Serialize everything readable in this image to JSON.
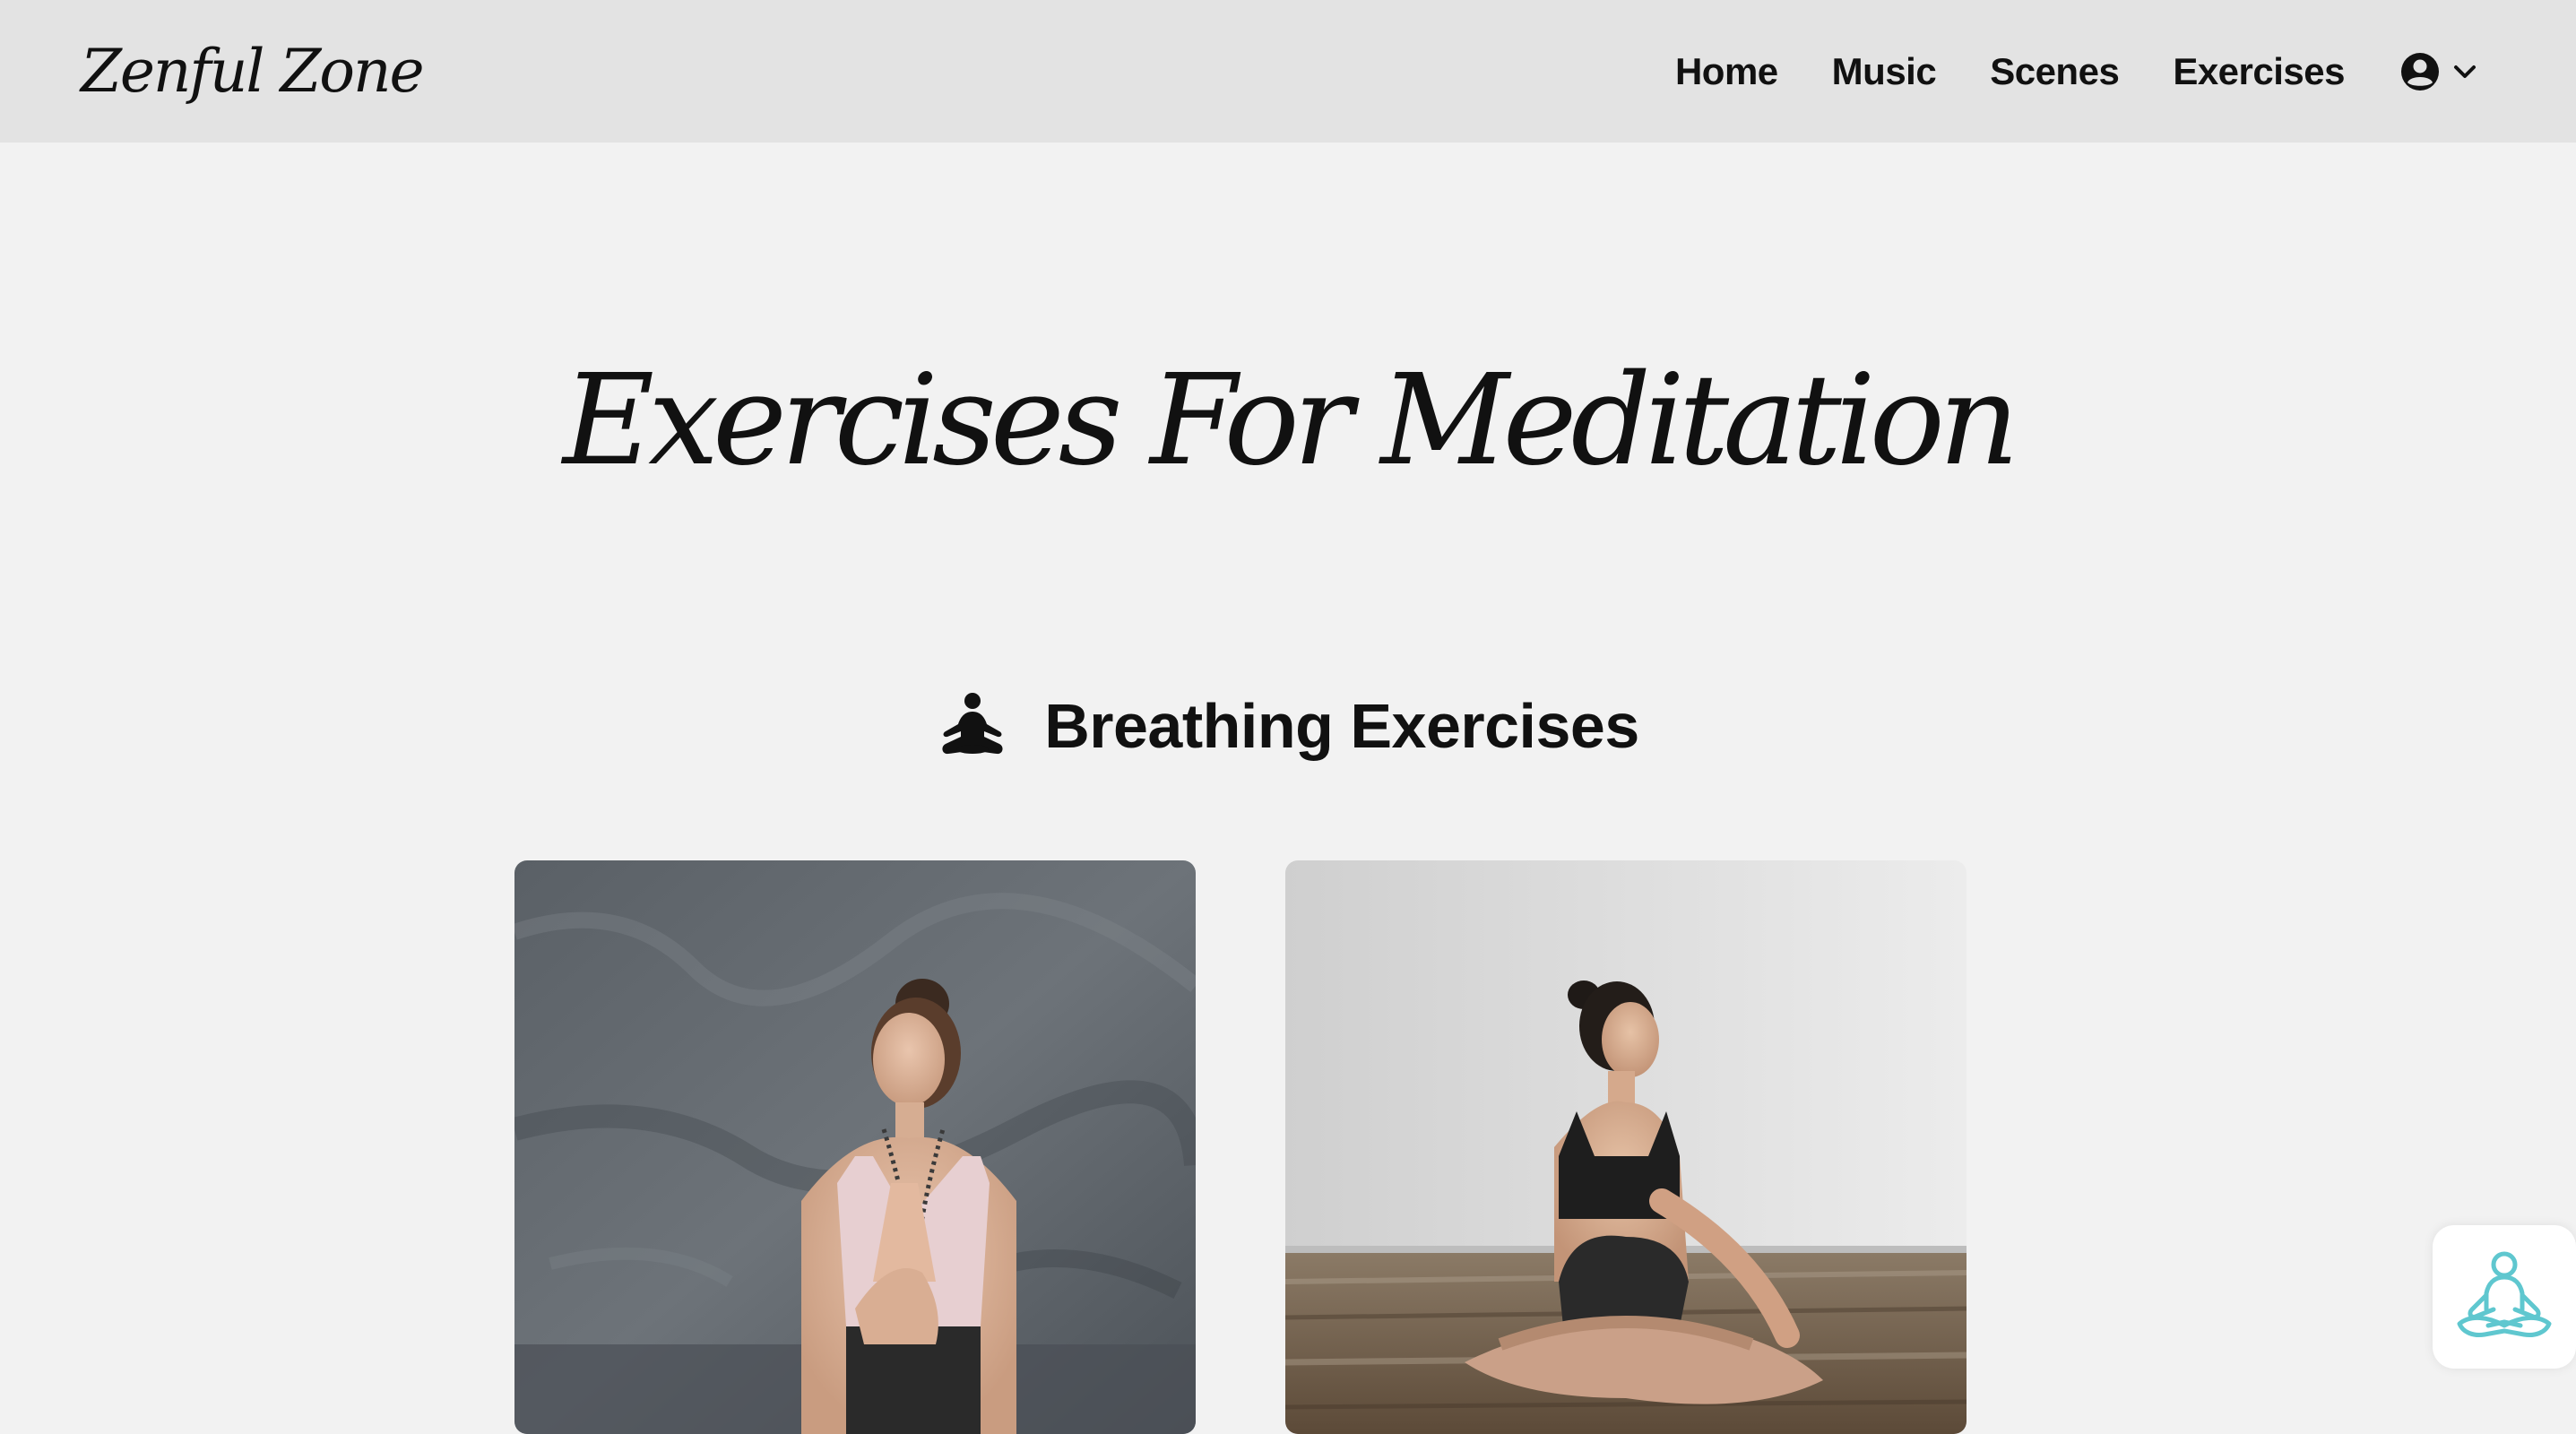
{
  "brand": {
    "logo_text": "Zenful Zone"
  },
  "nav": {
    "links": [
      {
        "label": "Home"
      },
      {
        "label": "Music"
      },
      {
        "label": "Scenes"
      },
      {
        "label": "Exercises"
      }
    ],
    "user_icon": "user-circle-icon",
    "dropdown_icon": "chevron-down-icon"
  },
  "page": {
    "title": "Exercises For Meditation"
  },
  "section": {
    "icon": "meditation-person-icon",
    "title": "Breathing Exercises"
  },
  "cards": [
    {
      "image": "woman in pink top with prayer hands and mala beads"
    },
    {
      "image": "woman in black sportswear seated cross-legged twisting"
    }
  ],
  "floating_button": {
    "icon": "meditation-outline-icon",
    "accent_color": "#5fc7cf"
  },
  "colors": {
    "navbar_bg": "#e3e3e3",
    "page_bg": "#f2f2f2",
    "text": "#111111",
    "accent": "#5fc7cf"
  }
}
